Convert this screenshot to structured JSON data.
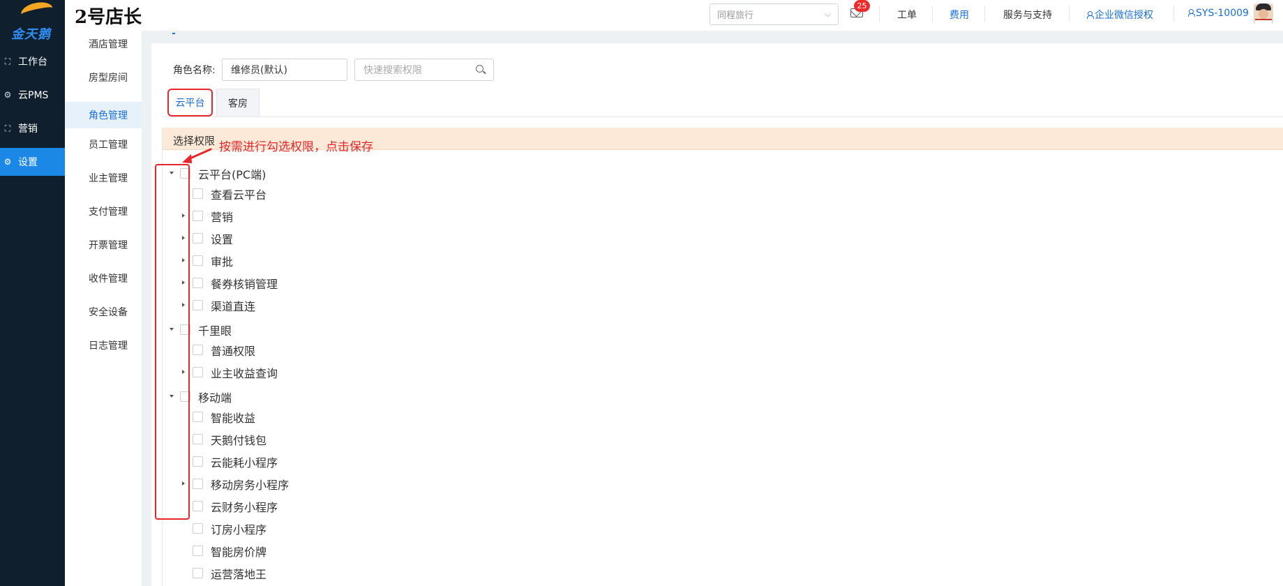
{
  "app": {
    "logo_text": "金天鹅",
    "brand_title": "2号店长"
  },
  "left_nav": {
    "items": [
      {
        "label": "工作台",
        "icon": "workbench-icon",
        "active": false
      },
      {
        "label": "云PMS",
        "icon": "gear-icon",
        "active": false
      },
      {
        "label": "营销",
        "icon": "scan-icon",
        "active": false
      },
      {
        "label": "设置",
        "icon": "gear-icon",
        "active": true
      }
    ]
  },
  "sub_nav": {
    "items": [
      {
        "label": "酒店管理",
        "active": false
      },
      {
        "label": "房型房间",
        "active": false
      },
      {
        "label": "角色管理",
        "active": true
      },
      {
        "label": "员工管理",
        "active": false
      },
      {
        "label": "业主管理",
        "active": false
      },
      {
        "label": "支付管理",
        "active": false
      },
      {
        "label": "开票管理",
        "active": false
      },
      {
        "label": "收件管理",
        "active": false
      },
      {
        "label": "安全设备",
        "active": false
      },
      {
        "label": "日志管理",
        "active": false
      }
    ]
  },
  "header": {
    "org_select_placeholder": "同程旅行",
    "mail_badge": "25",
    "links": {
      "ticket": "工单",
      "fee": "费用",
      "service": "服务与支持",
      "wechat_auth": "企业微信授权",
      "user": "SYS-10009"
    }
  },
  "role_form": {
    "label": "角色名称:",
    "role_value": "维修员(默认)",
    "search_placeholder": "快速搜索权限"
  },
  "tabs": [
    {
      "label": "云平台",
      "active": true
    },
    {
      "label": "客房",
      "active": false
    }
  ],
  "permissions": {
    "header_label": "选择权限",
    "annotation": "按需进行勾选权限，点击保存",
    "tree": [
      {
        "label": "云平台(PC端)",
        "level": 0,
        "expandable": true,
        "expanded": true
      },
      {
        "label": "查看云平台",
        "level": 1,
        "expandable": false
      },
      {
        "label": "营销",
        "level": 1,
        "expandable": true
      },
      {
        "label": "设置",
        "level": 1,
        "expandable": true
      },
      {
        "label": "审批",
        "level": 1,
        "expandable": true
      },
      {
        "label": "餐券核销管理",
        "level": 1,
        "expandable": true
      },
      {
        "label": "渠道直连",
        "level": 1,
        "expandable": true
      },
      {
        "label": "千里眼",
        "level": 0,
        "expandable": true,
        "expanded": true
      },
      {
        "label": "普通权限",
        "level": 1,
        "expandable": false
      },
      {
        "label": "业主收益查询",
        "level": 1,
        "expandable": true
      },
      {
        "label": "移动端",
        "level": 0,
        "expandable": true,
        "expanded": true
      },
      {
        "label": "智能收益",
        "level": 1,
        "expandable": false
      },
      {
        "label": "天鹅付钱包",
        "level": 1,
        "expandable": false
      },
      {
        "label": "云能耗小程序",
        "level": 1,
        "expandable": false
      },
      {
        "label": "移动房务小程序",
        "level": 1,
        "expandable": true
      },
      {
        "label": "云财务小程序",
        "level": 1,
        "expandable": false
      },
      {
        "label": "订房小程序",
        "level": 1,
        "expandable": false
      },
      {
        "label": "智能房价牌",
        "level": 1,
        "expandable": false
      },
      {
        "label": "运营落地王",
        "level": 1,
        "expandable": false
      }
    ]
  },
  "colors": {
    "nav_bg": "#0f1f2e",
    "accent_blue": "#1b88e8",
    "highlight_red": "#e8262b",
    "header_peach": "#fce9d8"
  }
}
